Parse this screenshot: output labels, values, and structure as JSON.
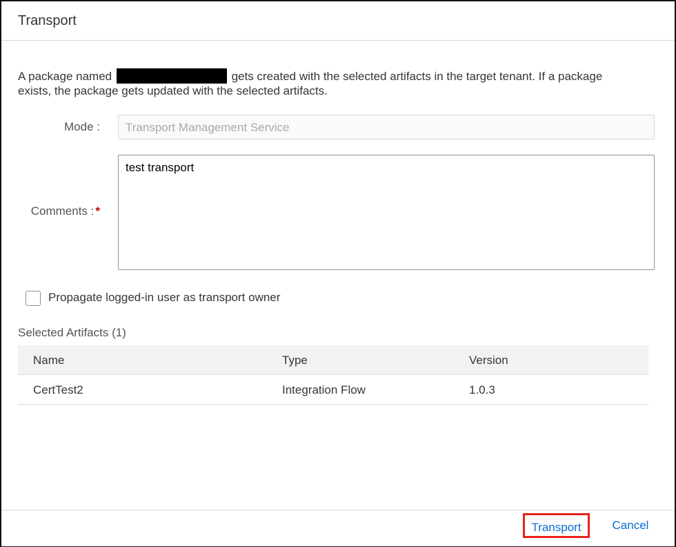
{
  "dialog": {
    "title": "Transport",
    "intro_before": "A package named",
    "intro_after": "gets created with the selected artifacts in the target tenant. If a package exists, the package gets updated with the selected artifacts."
  },
  "form": {
    "mode_label": "Mode :",
    "mode_value": "Transport Management Service",
    "comments_label": "Comments :",
    "comments_required_marker": "*",
    "comments_value": "test transport",
    "checkbox_label": "Propagate logged-in user as transport owner",
    "checkbox_checked": false
  },
  "artifacts": {
    "title": "Selected Artifacts (1)",
    "columns": [
      "Name",
      "Type",
      "Version"
    ],
    "rows": [
      {
        "name": "CertTest2",
        "type": "Integration Flow",
        "version": "1.0.3"
      }
    ]
  },
  "footer": {
    "transport_label": "Transport",
    "cancel_label": "Cancel"
  },
  "colors": {
    "accent": "#0a6ed1",
    "highlight_box": "#e8231b",
    "required": "#bb0000"
  }
}
